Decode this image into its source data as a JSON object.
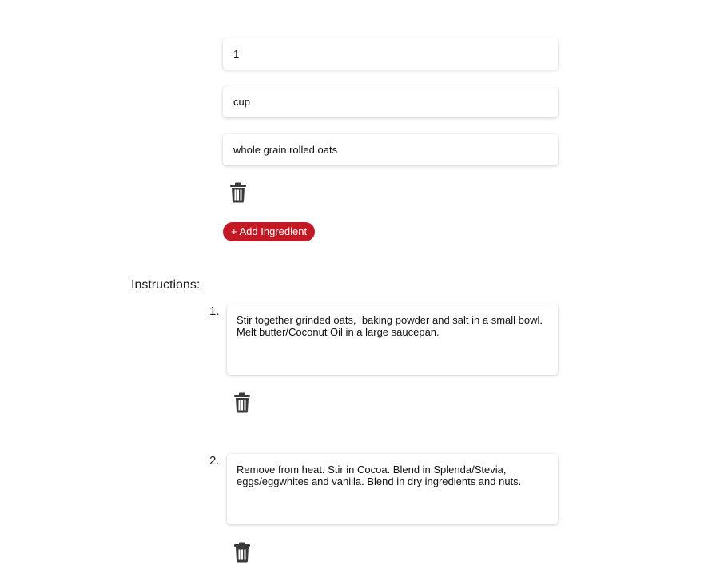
{
  "ingredient": {
    "quantity_value": "1",
    "unit_value": "cup",
    "name_value": "whole grain rolled oats"
  },
  "add_ingredient_label": "+ Add Ingredient",
  "instructions": {
    "label": "Instructions:",
    "steps": [
      {
        "number": "1.",
        "text": "Stir together grinded oats,  baking powder and salt in a small bowl. Melt butter/Coconut Oil in a large saucepan."
      },
      {
        "number": "2.",
        "text": "Remove from heat. Stir in Cocoa. Blend in Splenda/Stevia, eggs/eggwhites and vanilla. Blend in dry ingredients and nuts."
      }
    ]
  },
  "icons": {
    "delete": "trash-icon"
  },
  "colors": {
    "accent": "#c21a25",
    "icon": "#3a3a3a"
  }
}
